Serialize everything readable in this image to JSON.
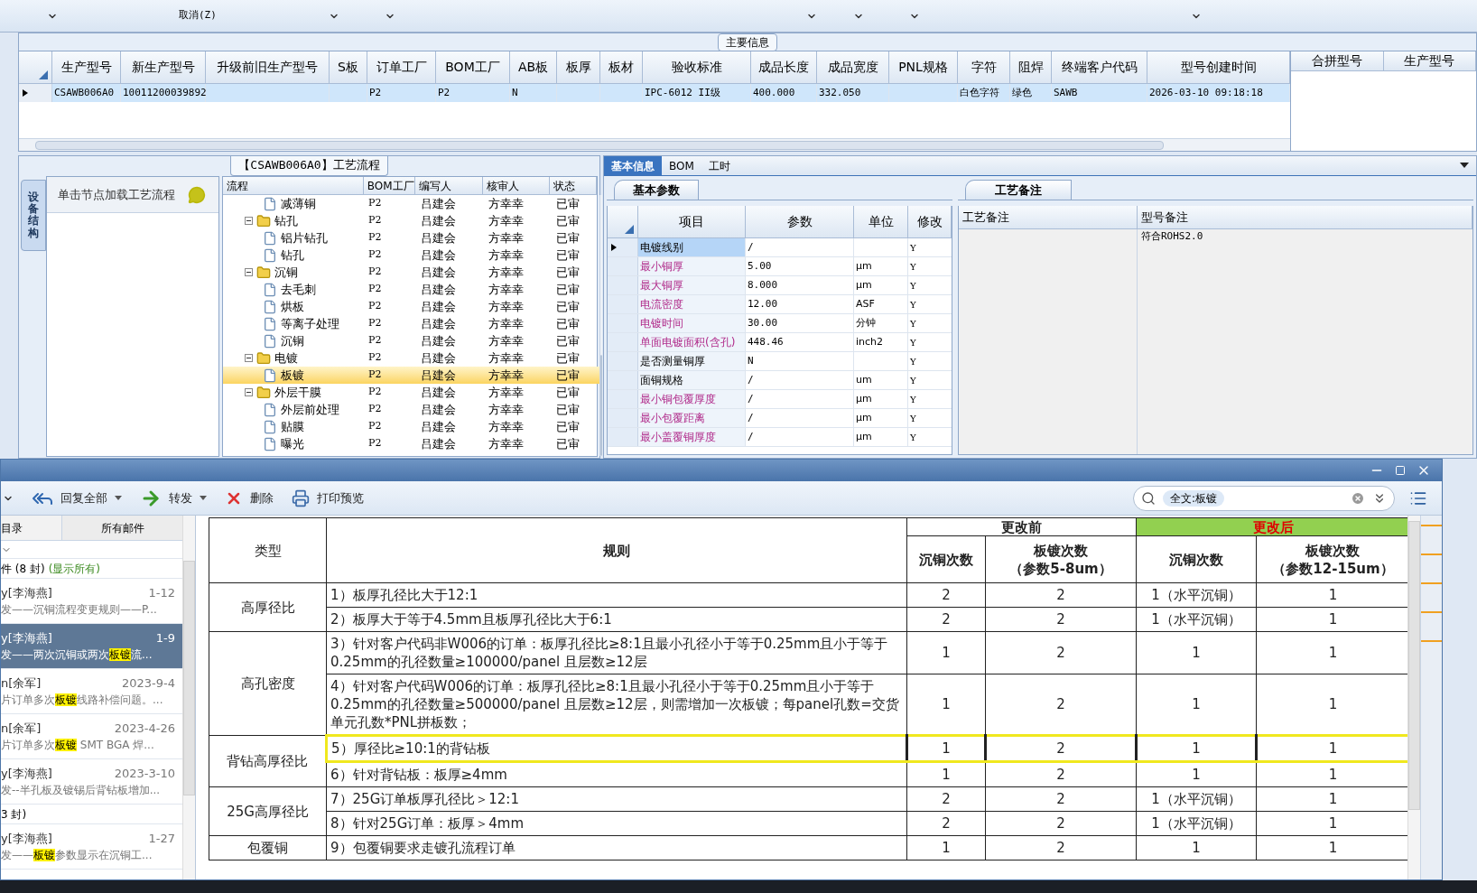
{
  "toolbar": {
    "cancel_label": "取消(Z)"
  },
  "main_info": {
    "title": "主要信息",
    "row_selected": true,
    "columns": [
      {
        "label": "生产型号",
        "value": "CSAWB006A0"
      },
      {
        "label": "新生产型号",
        "value": "10011200039892"
      },
      {
        "label": "升级前旧生产型号"
      },
      {
        "label": "S板"
      },
      {
        "label": "订单工厂",
        "value": "P2"
      },
      {
        "label": "BOM工厂",
        "value": "P2"
      },
      {
        "label": "AB板",
        "value": "N"
      },
      {
        "label": "板厚"
      },
      {
        "label": "板材"
      },
      {
        "label": "验收标准",
        "value": "IPC-6012 II级"
      },
      {
        "label": "成品长度",
        "value": "400.000"
      },
      {
        "label": "成品宽度",
        "value": "332.050"
      },
      {
        "label": "PNL规格"
      },
      {
        "label": "字符",
        "value": "白色字符"
      },
      {
        "label": "阻焊",
        "value": "绿色"
      },
      {
        "label": "终端客户代码",
        "value": "SAWB"
      },
      {
        "label": "型号创建时间",
        "value": "2026-03-10 09:18:18"
      }
    ],
    "side_columns": [
      "合拼型号",
      "生产型号"
    ]
  },
  "process": {
    "title": "【CSAWB006A0】工艺流程",
    "side_tab": "设备结构",
    "hint": "单击节点加载工艺流程",
    "columns": [
      "流程",
      "BOM工厂",
      "编写人",
      "核审人",
      "状态"
    ],
    "nodes": [
      {
        "name": "减薄铜",
        "kind": "file",
        "bom": "P2",
        "author": "吕建会",
        "reviewer": "方幸幸",
        "status": "已审",
        "selected": false
      },
      {
        "name": "钻孔",
        "kind": "folder",
        "expanded": true,
        "bom": "P2",
        "author": "吕建会",
        "reviewer": "方幸幸",
        "status": "已审",
        "selected": false,
        "children": [
          {
            "name": "铝片钻孔",
            "kind": "file",
            "bom": "P2",
            "author": "吕建会",
            "reviewer": "方幸幸",
            "status": "已审",
            "selected": false
          },
          {
            "name": "钻孔",
            "kind": "file",
            "bom": "P2",
            "author": "吕建会",
            "reviewer": "方幸幸",
            "status": "已审",
            "selected": false
          }
        ]
      },
      {
        "name": "沉铜",
        "kind": "folder",
        "expanded": true,
        "bom": "P2",
        "author": "吕建会",
        "reviewer": "方幸幸",
        "status": "已审",
        "selected": false,
        "children": [
          {
            "name": "去毛刺",
            "kind": "file",
            "bom": "P2",
            "author": "吕建会",
            "reviewer": "方幸幸",
            "status": "已审",
            "selected": false
          },
          {
            "name": "烘板",
            "kind": "file",
            "bom": "P2",
            "author": "吕建会",
            "reviewer": "方幸幸",
            "status": "已审",
            "selected": false
          },
          {
            "name": "等离子处理",
            "kind": "file",
            "bom": "P2",
            "author": "吕建会",
            "reviewer": "方幸幸",
            "status": "已审",
            "selected": false
          },
          {
            "name": "沉铜",
            "kind": "file",
            "bom": "P2",
            "author": "吕建会",
            "reviewer": "方幸幸",
            "status": "已审",
            "selected": false
          }
        ]
      },
      {
        "name": "电镀",
        "kind": "folder",
        "expanded": true,
        "bom": "P2",
        "author": "吕建会",
        "reviewer": "方幸幸",
        "status": "已审",
        "selected": false,
        "children": [
          {
            "name": "板镀",
            "kind": "file",
            "bom": "P2",
            "author": "吕建会",
            "reviewer": "方幸幸",
            "status": "已审",
            "selected": true
          }
        ]
      },
      {
        "name": "外层干膜",
        "kind": "folder",
        "expanded": true,
        "bom": "P2",
        "author": "吕建会",
        "reviewer": "方幸幸",
        "status": "已审",
        "selected": false,
        "children": [
          {
            "name": "外层前处理",
            "kind": "file",
            "bom": "P2",
            "author": "吕建会",
            "reviewer": "方幸幸",
            "status": "已审",
            "selected": false
          },
          {
            "name": "贴膜",
            "kind": "file",
            "bom": "P2",
            "author": "吕建会",
            "reviewer": "方幸幸",
            "status": "已审",
            "selected": false
          },
          {
            "name": "曝光",
            "kind": "file",
            "bom": "P2",
            "author": "吕建会",
            "reviewer": "方幸幸",
            "status": "已审",
            "selected": false
          }
        ]
      }
    ]
  },
  "details": {
    "tabs": [
      {
        "label": "基本信息",
        "selected": true
      },
      {
        "label": "BOM",
        "selected": false
      },
      {
        "label": "工时",
        "selected": false
      }
    ],
    "params_tab": "基本参数",
    "params_columns": [
      "项目",
      "参数",
      "单位",
      "修改"
    ],
    "params": [
      {
        "item": "电镀线别",
        "value": "/",
        "modify": "Y",
        "highlighted": false,
        "selected": true
      },
      {
        "item": "最小铜厚",
        "value": "5.00",
        "unit": "μm",
        "modify": "Y",
        "highlighted": true,
        "selected": false
      },
      {
        "item": "最大铜厚",
        "value": "8.000",
        "unit": "μm",
        "modify": "Y",
        "highlighted": true,
        "selected": false
      },
      {
        "item": "电流密度",
        "value": "12.00",
        "unit": "ASF",
        "modify": "Y",
        "highlighted": true,
        "selected": false
      },
      {
        "item": "电镀时间",
        "value": "30.00",
        "unit": "分钟",
        "modify": "Y",
        "highlighted": true,
        "selected": false
      },
      {
        "item": "单面电镀面积(含孔)",
        "value": "448.46",
        "unit": "inch2",
        "modify": "Y",
        "highlighted": true,
        "selected": false
      },
      {
        "item": "是否测量铜厚",
        "value": "N",
        "modify": "Y",
        "highlighted": false,
        "selected": false
      },
      {
        "item": "面铜规格",
        "value": "/",
        "unit": "um",
        "modify": "Y",
        "highlighted": false,
        "selected": false
      },
      {
        "item": "最小铜包覆厚度",
        "value": "/",
        "unit": "μm",
        "modify": "Y",
        "highlighted": true,
        "selected": false
      },
      {
        "item": "最小包覆距离",
        "value": "/",
        "unit": "μm",
        "modify": "Y",
        "highlighted": true,
        "selected": false
      },
      {
        "item": "最小盖覆铜厚度",
        "value": "/",
        "unit": "μm",
        "modify": "Y",
        "highlighted": true,
        "selected": false
      }
    ],
    "notes_tab": "工艺备注",
    "notes_columns": [
      "工艺备注",
      "型号备注"
    ],
    "model_note": "符合ROHS2.0"
  },
  "mail": {
    "toolbar": [
      {
        "label": "回复全部",
        "kind": "reply_all",
        "menu": true
      },
      {
        "label": "转发",
        "kind": "forward",
        "menu": true
      },
      {
        "label": "删除",
        "kind": "delete",
        "menu": false
      },
      {
        "label": "打印预览",
        "kind": "print",
        "menu": false
      }
    ],
    "search_token": "全文:板镀",
    "folder_tabs": [
      "目录",
      "所有邮件"
    ],
    "groups": [
      {
        "title": "件 (8 封)",
        "show_all": "(显示所有)",
        "items": [
          {
            "sender": "y[李海燕]",
            "date": "1-12",
            "selected": false,
            "subject": [
              {
                "text": "发——沉铜流程变更规则——P...",
                "highlight": false
              }
            ]
          },
          {
            "sender": "y[李海燕]",
            "date": "1-9",
            "selected": true,
            "subject": [
              {
                "text": "发——两次沉铜或两次",
                "highlight": false
              },
              {
                "text": "板镀",
                "highlight": true
              },
              {
                "text": "流...",
                "highlight": false
              }
            ]
          },
          {
            "sender": "n[余军]",
            "date": "2023-9-4",
            "selected": false,
            "subject": [
              {
                "text": "片订单多次",
                "highlight": false
              },
              {
                "text": "板镀",
                "highlight": true
              },
              {
                "text": "线路补偿问题。...",
                "highlight": false
              }
            ]
          },
          {
            "sender": "n[余军]",
            "date": "2023-4-26",
            "selected": false,
            "subject": [
              {
                "text": "片订单多次",
                "highlight": false
              },
              {
                "text": "板镀",
                "highlight": true
              },
              {
                "text": " SMT BGA 焊...",
                "highlight": false
              }
            ]
          },
          {
            "sender": "y[李海燕]",
            "date": "2023-3-10",
            "selected": false,
            "subject": [
              {
                "text": "发--半孔板及镀锡后背钻板增加...",
                "highlight": false
              }
            ]
          }
        ]
      },
      {
        "title": "3 封)",
        "items": [
          {
            "sender": "y[李海燕]",
            "date": "1-27",
            "selected": false,
            "subject": [
              {
                "text": "发——",
                "highlight": false
              },
              {
                "text": "板镀",
                "highlight": true
              },
              {
                "text": "参数显示在沉铜工...",
                "highlight": false
              }
            ]
          }
        ]
      }
    ],
    "table": {
      "type_header": "类型",
      "rule_header": "规则",
      "before_header": "更改前",
      "after_header": "更改后",
      "sub_headers": [
        [
          "沉铜次数"
        ],
        [
          "板镀次数",
          "（参数5-8um）"
        ],
        [
          "沉铜次数"
        ],
        [
          "板镀次数",
          "（参数12-15um）"
        ]
      ],
      "groups": [
        {
          "type": "高厚径比",
          "rules": [
            {
              "text": "1）板厚孔径比大于12:1",
              "values": [
                "2",
                "2",
                "1（水平沉铜）",
                "1"
              ],
              "highlighted": false
            },
            {
              "text": "2）板厚大于等于4.5mm且板厚孔径比大于6:1",
              "values": [
                "2",
                "2",
                "1（水平沉铜）",
                "1"
              ],
              "highlighted": false
            }
          ]
        },
        {
          "type": "高孔密度",
          "rules": [
            {
              "text": "3）针对客户代码非W006的订单：板厚孔径比≥8:1且最小孔径小于等于0.25mm且小于等于0.25mm的孔径数量≥100000/panel 且层数≥12层",
              "values": [
                "1",
                "2",
                "1",
                "1"
              ],
              "highlighted": false
            },
            {
              "text": "4）针对客户代码W006的订单：板厚孔径比≥8:1且最小孔径小于等于0.25mm且小于等于0.25mm的孔径数量≥500000/panel 且层数≥12层，则需增加一次板镀；每panel孔数=交货单元孔数*PNL拼板数；",
              "values": [
                "1",
                "2",
                "1",
                "1"
              ],
              "highlighted": false
            }
          ]
        },
        {
          "type": "背钻高厚径比",
          "rules": [
            {
              "text": "5）厚径比≥10:1的背钻板",
              "values": [
                "1",
                "2",
                "1",
                "1"
              ],
              "highlighted": true
            },
            {
              "text": "6）针对背钻板：板厚≥4mm",
              "values": [
                "1",
                "2",
                "1",
                "1"
              ],
              "highlighted": false
            }
          ]
        },
        {
          "type": "25G高厚径比",
          "rules": [
            {
              "text": "7）25G订单板厚孔径比＞12:1",
              "values": [
                "2",
                "2",
                "1（水平沉铜）",
                "1"
              ],
              "highlighted": false
            },
            {
              "text": "8）针对25G订单：板厚＞4mm",
              "values": [
                "2",
                "2",
                "1（水平沉铜）",
                "1"
              ],
              "highlighted": false
            }
          ]
        },
        {
          "type": "包覆铜",
          "rules": [
            {
              "text": "9）包覆铜要求走镀孔流程订单",
              "values": [
                "1",
                "2",
                "1",
                "1"
              ],
              "highlighted": false
            }
          ]
        }
      ]
    }
  }
}
